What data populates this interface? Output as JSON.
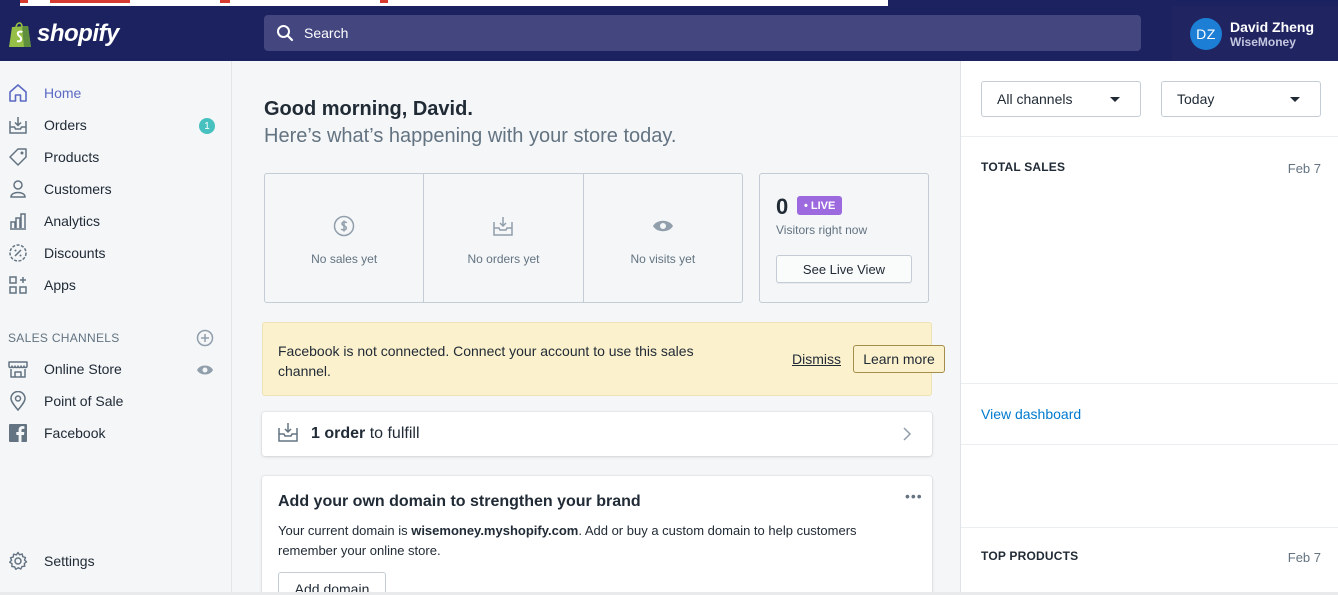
{
  "brand": {
    "name": "shopify"
  },
  "search": {
    "placeholder": "Search"
  },
  "user": {
    "initials": "DZ",
    "name": "David Zheng",
    "store": "WiseMoney"
  },
  "sidebar": {
    "items": [
      {
        "label": "Home",
        "icon": "home-icon"
      },
      {
        "label": "Orders",
        "icon": "orders-icon",
        "badge": "1"
      },
      {
        "label": "Products",
        "icon": "tag-icon"
      },
      {
        "label": "Customers",
        "icon": "person-icon"
      },
      {
        "label": "Analytics",
        "icon": "bar-chart-icon"
      },
      {
        "label": "Discounts",
        "icon": "discount-icon"
      },
      {
        "label": "Apps",
        "icon": "apps-icon"
      }
    ],
    "sales_channels_label": "SALES CHANNELS",
    "channels": [
      {
        "label": "Online Store",
        "icon": "store-icon"
      },
      {
        "label": "Point of Sale",
        "icon": "location-pin-icon"
      },
      {
        "label": "Facebook",
        "icon": "facebook-icon"
      }
    ],
    "settings_label": "Settings"
  },
  "main": {
    "greeting": "Good morning, David.",
    "subtitle": "Here’s what’s happening with your store today.",
    "stats": [
      {
        "label": "No sales yet",
        "icon": "dollar-circle-icon"
      },
      {
        "label": "No orders yet",
        "icon": "inbox-icon"
      },
      {
        "label": "No visits yet",
        "icon": "eye-icon"
      }
    ],
    "live": {
      "count": "0",
      "pill": "• LIVE",
      "subtitle": "Visitors right now",
      "button": "See Live View"
    },
    "banner": {
      "text": "Facebook is not connected. Connect your account to use this sales channel.",
      "dismiss": "Dismiss",
      "learn_more": "Learn more"
    },
    "fulfill": {
      "count_text": "1 order",
      "rest_text": " to fulfill"
    },
    "domain": {
      "title": "Add your own domain to strengthen your brand",
      "text_before": "Your current domain is ",
      "domain": "wisemoney.myshopify.com",
      "text_after": ". Add or buy a custom domain to help customers remember your online store.",
      "button": "Add domain",
      "more": "•••"
    }
  },
  "right_panel": {
    "channel_select": "All channels",
    "date_select": "Today",
    "total_sales_label": "TOTAL SALES",
    "total_sales_date": "Feb 7",
    "view_dashboard": "View dashboard",
    "top_products_label": "TOP PRODUCTS",
    "top_products_date": "Feb 7"
  },
  "colors": {
    "topbar": "#1c2260",
    "accent": "#5c6ac4",
    "badge": "#47c1bf",
    "live": "#9c6ade",
    "banner": "#fcf1cd",
    "link": "#007ace"
  }
}
